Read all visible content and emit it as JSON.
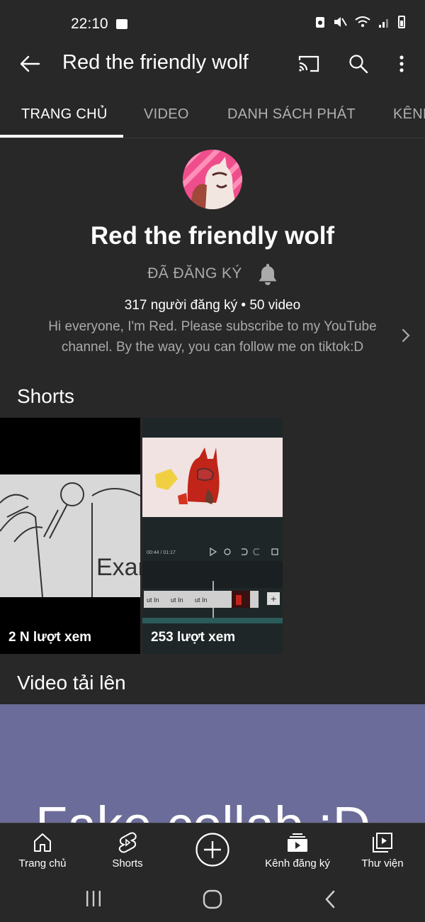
{
  "status": {
    "time": "22:10"
  },
  "app_bar": {
    "title": "Red the friendly wolf"
  },
  "tabs": [
    {
      "label": "TRANG CHỦ"
    },
    {
      "label": "VIDEO"
    },
    {
      "label": "DANH SÁCH PHÁT"
    },
    {
      "label": "KÊNH"
    }
  ],
  "channel": {
    "name": "Red the friendly wolf",
    "subscribed_label": "ĐÃ ĐĂNG KÝ",
    "stats": "317 người đăng ký • 50 video",
    "description": "Hi everyone, I'm Red. Please subscribe to my YouTube channel. By the way, you can follow me on tiktok:D"
  },
  "shorts": {
    "title": "Shorts",
    "items": [
      {
        "views": "2 N lượt xem"
      },
      {
        "views": "253 lượt xem"
      }
    ],
    "sketch_text": "Exan",
    "editor_time": "00:44 / 01:17",
    "clip_label": "ut In"
  },
  "uploads": {
    "title": "Video tải lên",
    "thumb_text": "Fake collab :D"
  },
  "bottom_nav": [
    {
      "label": "Trang chủ"
    },
    {
      "label": "Shorts"
    },
    {
      "label": ""
    },
    {
      "label": "Kênh đăng ký"
    },
    {
      "label": "Thư viện"
    }
  ],
  "colors": {
    "background": "#282828",
    "video_thumb": "#6b6c99",
    "muted_text": "#aaaaaa"
  }
}
